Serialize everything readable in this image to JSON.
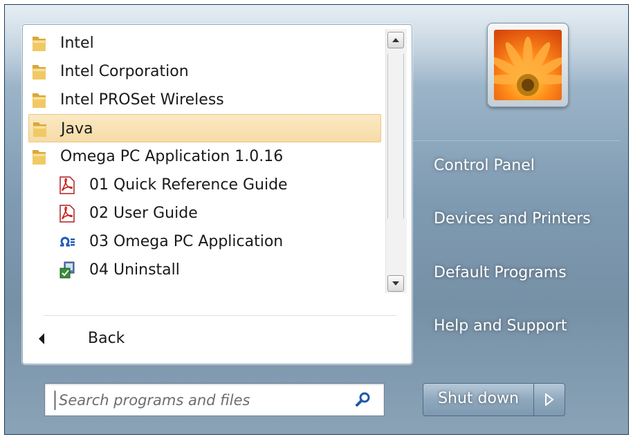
{
  "programs": {
    "items": [
      {
        "label": "Intel",
        "icon": "folder-icon",
        "level": 0,
        "selected": false
      },
      {
        "label": "Intel Corporation",
        "icon": "folder-icon",
        "level": 0,
        "selected": false
      },
      {
        "label": "Intel PROSet Wireless",
        "icon": "folder-icon",
        "level": 0,
        "selected": false
      },
      {
        "label": "Java",
        "icon": "folder-icon",
        "level": 0,
        "selected": true
      },
      {
        "label": "Omega PC Application 1.0.16",
        "icon": "folder-icon",
        "level": 0,
        "selected": false
      },
      {
        "label": "01 Quick Reference Guide",
        "icon": "pdf-icon",
        "level": 1,
        "selected": false
      },
      {
        "label": "02 User Guide",
        "icon": "pdf-icon",
        "level": 1,
        "selected": false
      },
      {
        "label": "03 Omega PC Application",
        "icon": "omega-app-icon",
        "level": 1,
        "selected": false
      },
      {
        "label": "04 Uninstall",
        "icon": "uninstall-icon",
        "level": 1,
        "selected": false
      }
    ],
    "back_label": "Back"
  },
  "search": {
    "placeholder": "Search programs and files",
    "icon": "search-icon"
  },
  "right_panel": {
    "user_picture_icon": "flower-avatar-icon",
    "items": [
      {
        "label": "Control Panel"
      },
      {
        "label": "Devices and Printers"
      },
      {
        "label": "Default Programs"
      },
      {
        "label": "Help and Support"
      }
    ],
    "shutdown_label": "Shut down",
    "shutdown_arrow_icon": "triangle-right-icon"
  },
  "colors": {
    "selection": "#f6dba6",
    "pane_bg": "#7f9bb2"
  }
}
